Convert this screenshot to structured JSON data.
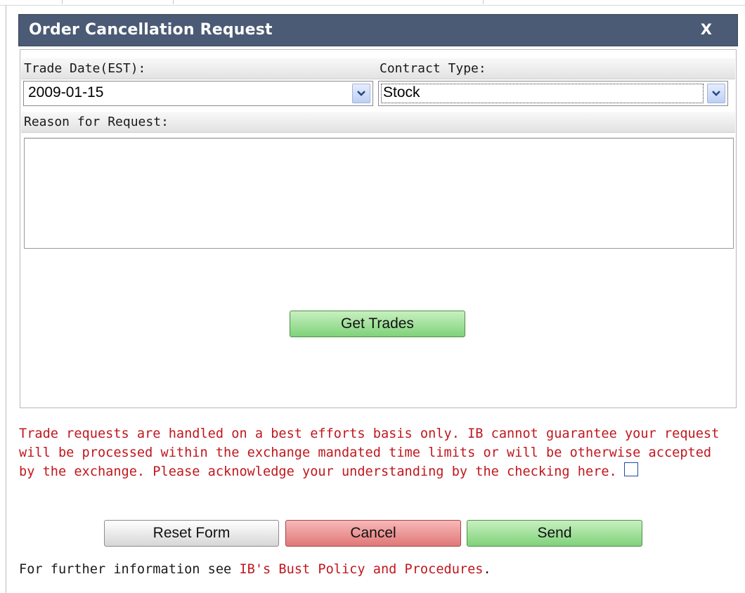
{
  "dialog": {
    "title": "Order Cancellation Request",
    "close_label": "X"
  },
  "form": {
    "trade_date_label": "Trade Date(EST):",
    "trade_date_value": "2009-01-15",
    "contract_type_label": "Contract Type:",
    "contract_type_value": "Stock",
    "reason_label": "Reason for Request:",
    "reason_value": "",
    "get_trades_label": "Get Trades"
  },
  "notice": {
    "text": "Trade requests are handled on a best efforts basis only. IB cannot guarantee your request will be processed within the exchange mandated time limits or will be otherwise accepted by the exchange. Please acknowledge your understanding by the checking here.",
    "acknowledged": false
  },
  "actions": {
    "reset_label": "Reset Form",
    "cancel_label": "Cancel",
    "send_label": "Send"
  },
  "footer": {
    "prefix": "For further information see ",
    "link_text": "IB's Bust Policy and Procedures",
    "suffix": "."
  },
  "colors": {
    "title_bar": "#4b5a75",
    "notice_text": "#c0171e",
    "green_button": "#7fd27a",
    "red_button": "#e07878"
  },
  "icons": {
    "dropdown": "chevron-down-icon"
  }
}
